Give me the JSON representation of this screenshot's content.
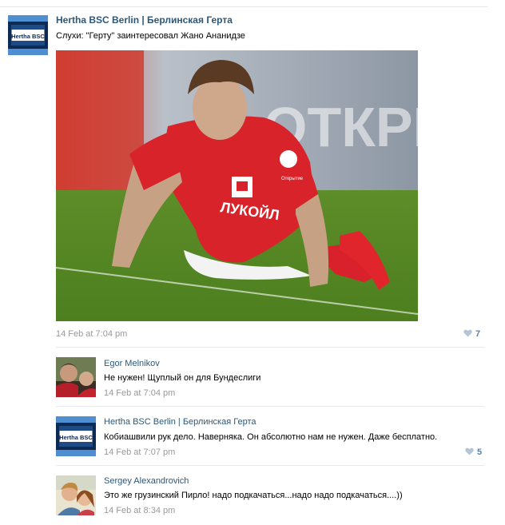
{
  "post": {
    "author": "Hertha BSC Berlin | Берлинская Герта",
    "text": "Слухи: \"Герту\" заинтересовал Жано Ананидзе",
    "date": "14 Feb at 7:04 pm",
    "likes": "7",
    "avatar_text": "Hertha BSC",
    "photo_text": {
      "sponsor": "ЛУКОЙЛ",
      "ad_board": "ОТКРЫ",
      "crest_text": "Открытие"
    }
  },
  "comments": [
    {
      "author": "Egor Melnikov",
      "text": "Не нужен! Щуплый он для Бундеслиги",
      "date": "14 Feb at 7:04 pm",
      "likes": ""
    },
    {
      "author": "Hertha BSC Berlin | Берлинская Герта",
      "text": "Кобиашвили рук дело. Наверняка. Он абсолютно нам не нужен. Даже бесплатно.",
      "date": "14 Feb at 7:07 pm",
      "likes": "5",
      "avatar_text": "Hertha BSC"
    },
    {
      "author": "Sergey Alexandrovich",
      "text": "Это же грузинский Пирло! надо подкачаться...надо надо подкачаться....))",
      "date": "14 Feb at 8:34 pm",
      "likes": ""
    }
  ],
  "colors": {
    "link": "#2b587a",
    "date": "#999999",
    "like": "#5e81a8",
    "hertha_blue": "#1e4b86"
  }
}
